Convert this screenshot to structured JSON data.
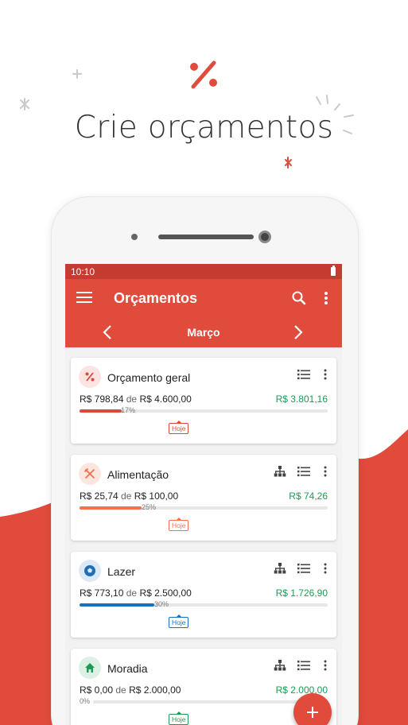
{
  "promo": {
    "headline": "Crie orçamentos"
  },
  "status_bar": {
    "time": "10:10"
  },
  "app_bar": {
    "title": "Orçamentos",
    "month": "Março"
  },
  "budgets": [
    {
      "name": "Orçamento geral",
      "spent": "R$ 798,84",
      "de": "de",
      "limit": "R$ 4.600,00",
      "remaining": "R$ 3.801,16",
      "percent_label": "17%",
      "progress": 0.17,
      "today_label": "Hoje",
      "color": "#d94a3c",
      "icon": "percent-icon",
      "subcategories_icon": false
    },
    {
      "name": "Alimentação",
      "spent": "R$ 25,74",
      "de": "de",
      "limit": "R$ 100,00",
      "remaining": "R$ 74,26",
      "percent_label": "25%",
      "progress": 0.25,
      "today_label": "Hoje",
      "color": "#f4714b",
      "icon": "fork-knife-icon",
      "subcategories_icon": true
    },
    {
      "name": "Lazer",
      "spent": "R$ 773,10",
      "de": "de",
      "limit": "R$ 2.500,00",
      "remaining": "R$ 1.726,90",
      "percent_label": "30%",
      "progress": 0.3,
      "today_label": "Hoje",
      "color": "#1d6fb8",
      "icon": "soccer-ball-icon",
      "subcategories_icon": true
    },
    {
      "name": "Moradia",
      "spent": "R$ 0,00",
      "de": "de",
      "limit": "R$ 2.000,00",
      "remaining": "R$ 2.000,00",
      "percent_label": "0%",
      "progress": 0.0,
      "today_label": "Hoje",
      "color": "#1e9a55",
      "icon": "home-icon",
      "subcategories_icon": true
    }
  ],
  "colors": {
    "brand": "#e04b3c",
    "status_bar": "#c43b2f",
    "positive": "#1e9a55"
  }
}
